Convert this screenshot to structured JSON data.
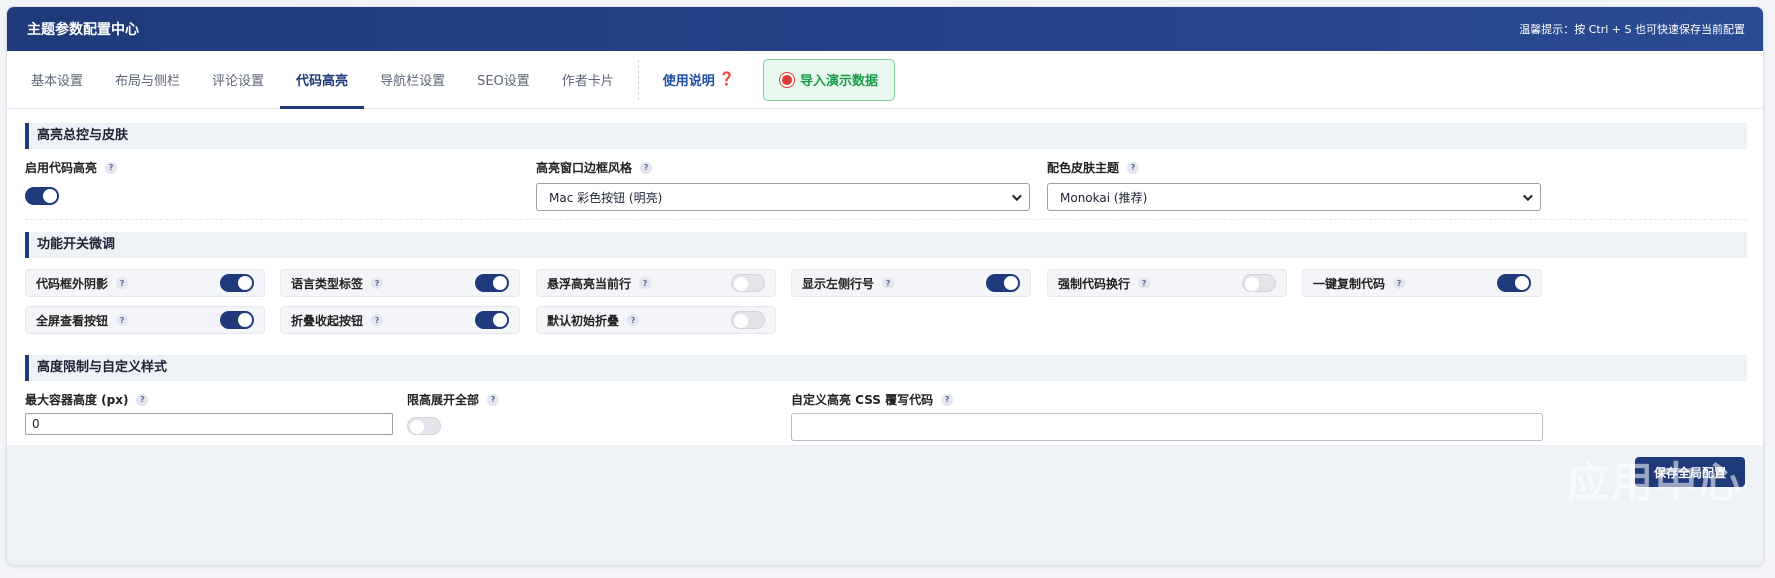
{
  "header": {
    "title": "主题参数配置中心",
    "tip": "温馨提示：按 Ctrl + S 也可快速保存当前配置"
  },
  "tabs": [
    {
      "label": "基本设置"
    },
    {
      "label": "布局与侧栏"
    },
    {
      "label": "评论设置"
    },
    {
      "label": "代码高亮",
      "active": true
    },
    {
      "label": "导航栏设置"
    },
    {
      "label": "SEO设置"
    },
    {
      "label": "作者卡片"
    }
  ],
  "help": {
    "label": "使用说明",
    "mark": "❓"
  },
  "import_button": {
    "label": "导入演示数据",
    "icon": "target-icon"
  },
  "section1": {
    "title": "高亮总控与皮肤",
    "enable": {
      "label": "启用代码高亮",
      "on": true
    },
    "border_style": {
      "label": "高亮窗口边框风格",
      "value": "Mac 彩色按钮 (明亮)"
    },
    "skin": {
      "label": "配色皮肤主题",
      "value": "Monokai (推荐)"
    }
  },
  "section2": {
    "title": "功能开关微调",
    "toggles": [
      {
        "label": "代码框外阴影",
        "on": true
      },
      {
        "label": "语言类型标签",
        "on": true
      },
      {
        "label": "悬浮高亮当前行",
        "on": false
      },
      {
        "label": "显示左侧行号",
        "on": true
      },
      {
        "label": "强制代码换行",
        "on": false
      },
      {
        "label": "一键复制代码",
        "on": true
      },
      {
        "label": "全屏查看按钮",
        "on": true
      },
      {
        "label": "折叠收起按钮",
        "on": true
      },
      {
        "label": "默认初始折叠",
        "on": false
      }
    ]
  },
  "section3": {
    "title": "高度限制与自定义样式",
    "max_height": {
      "label": "最大容器高度 (px)",
      "value": "0"
    },
    "expand_all": {
      "label": "限高展开全部",
      "on": false
    },
    "custom_css": {
      "label": "自定义高亮 CSS 覆写代码",
      "value": ""
    }
  },
  "help_badge": "?",
  "footer": {
    "save_label": "保存全局配置",
    "watermark": "应用中心"
  },
  "colors": {
    "primary": "#1f3a7a",
    "import_green": "#1a9a49",
    "toggle_off": "#e3e5ea"
  }
}
